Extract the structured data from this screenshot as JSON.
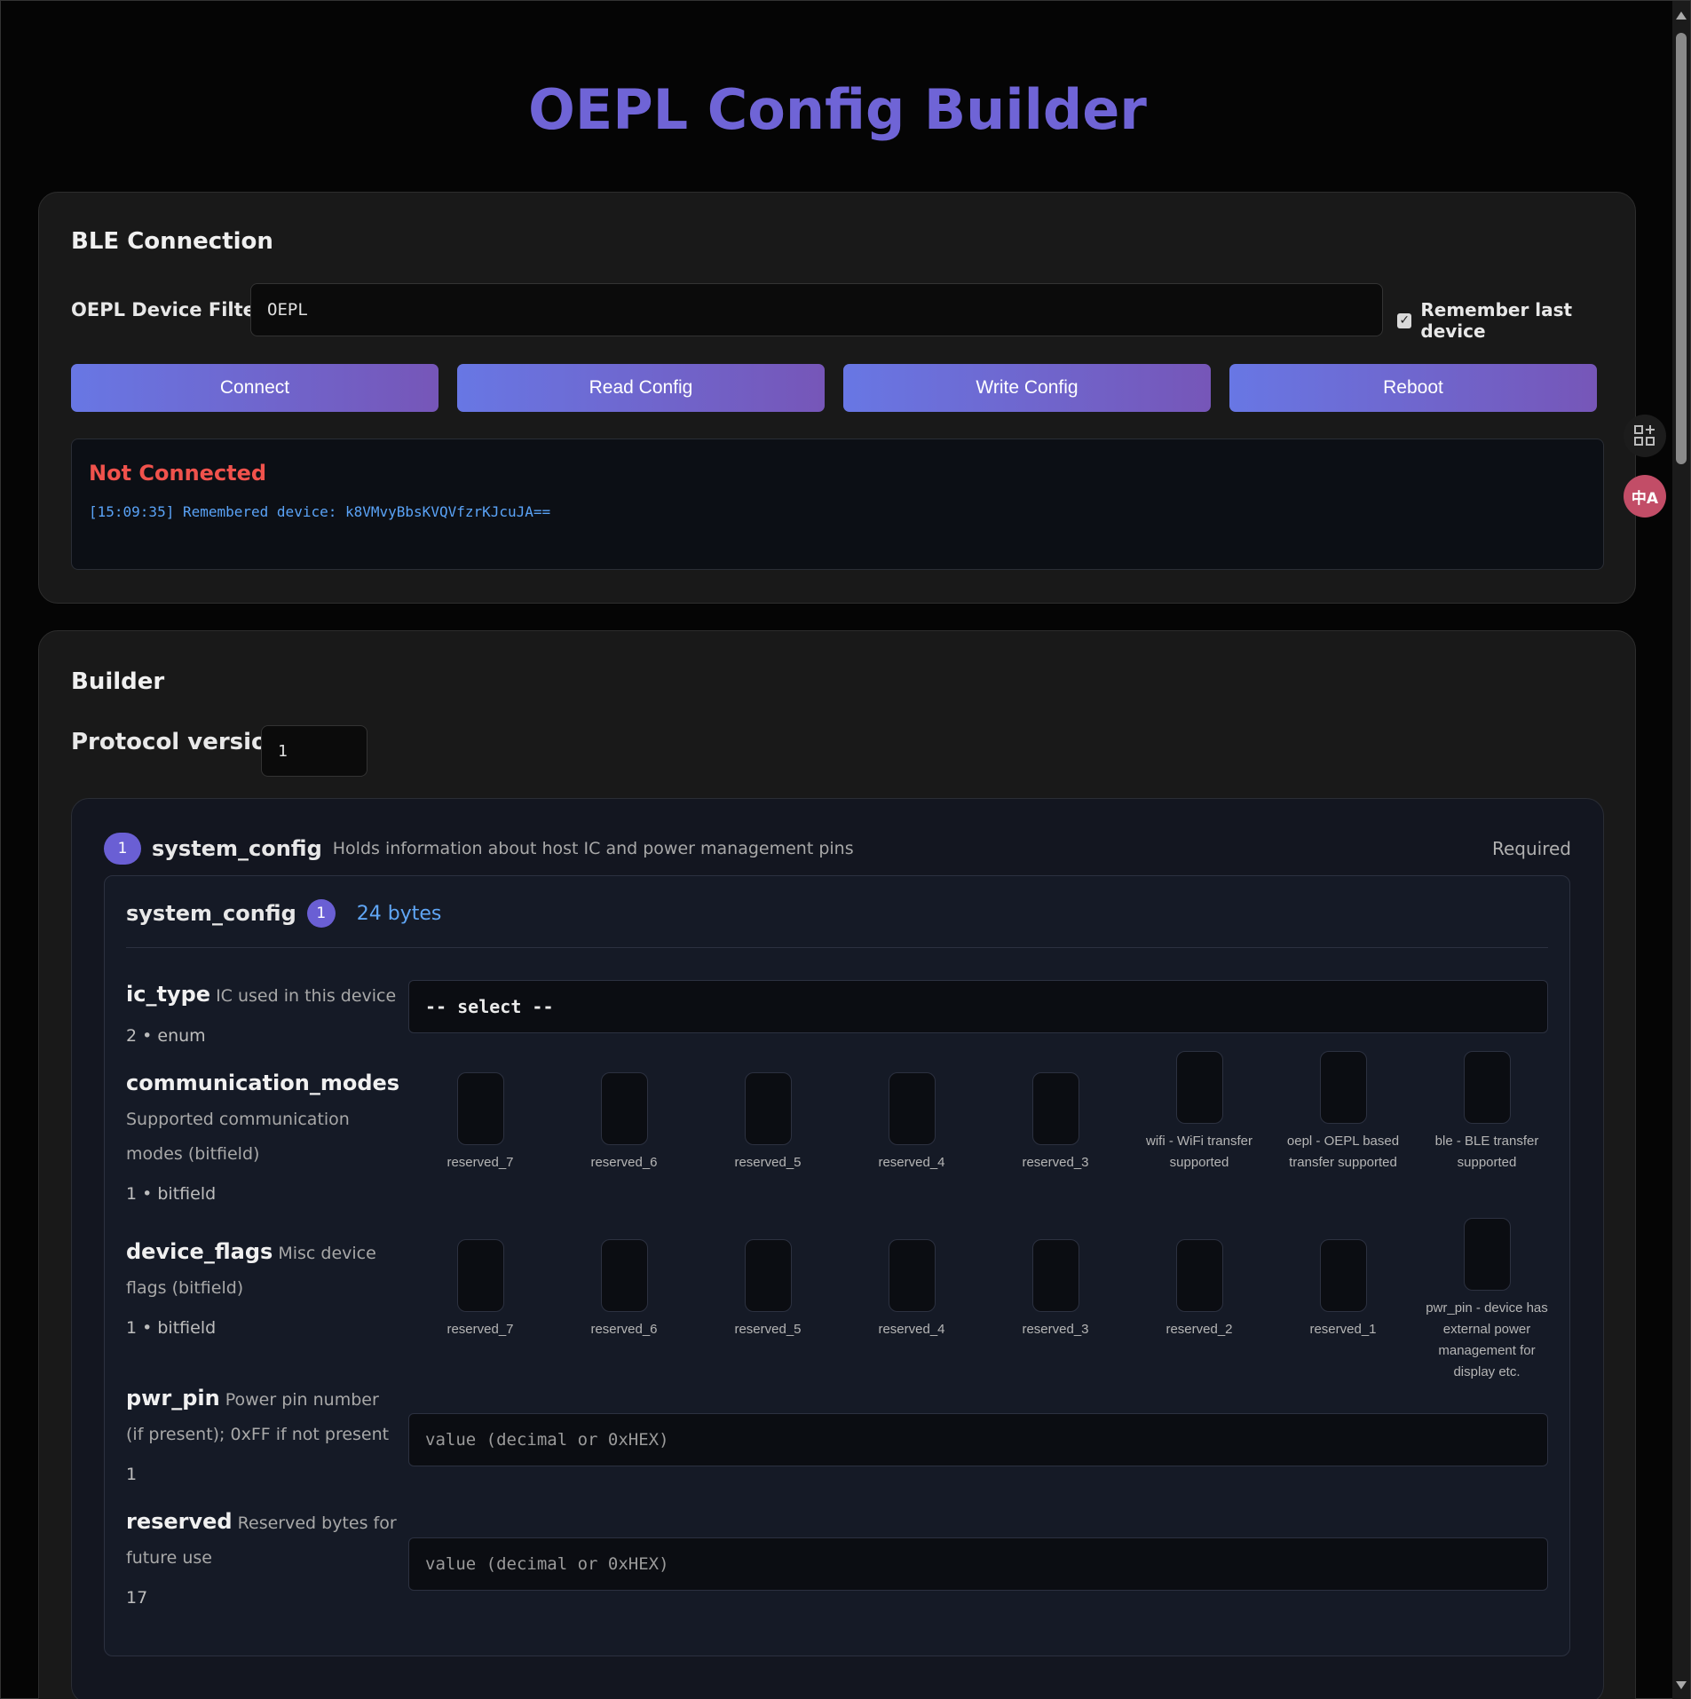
{
  "title": "OEPL Config Builder",
  "ble": {
    "heading": "BLE Connection",
    "filter_label": "OEPL Device Filter:",
    "filter_value": "OEPL",
    "remember_label": "Remember last device",
    "remember_checked": true,
    "buttons": {
      "connect": "Connect",
      "read": "Read Config",
      "write": "Write Config",
      "reboot": "Reboot"
    },
    "status": "Not Connected",
    "log": "[15:09:35] Remembered device: k8VMvyBbsKVQVfzrKJcuJA=="
  },
  "builder": {
    "heading": "Builder",
    "protocol_label": "Protocol version",
    "protocol_value": "1",
    "block": {
      "number": "1",
      "name": "system_config",
      "description": "Holds information about host IC and power management pins",
      "required": "Required",
      "inner_name": "system_config",
      "inner_number": "1",
      "bytes": "24 bytes",
      "fields": {
        "ic_type": {
          "name": "ic_type",
          "desc": "IC used in this device",
          "meta": "2 • enum",
          "select_value": "-- select --"
        },
        "communication_modes": {
          "name": "communication_modes",
          "desc": "Supported communication modes (bitfield)",
          "meta": "1 • bitfield",
          "bits": [
            "reserved_7",
            "reserved_6",
            "reserved_5",
            "reserved_4",
            "reserved_3",
            "wifi - WiFi transfer supported",
            "oepl - OEPL based transfer supported",
            "ble - BLE transfer supported"
          ]
        },
        "device_flags": {
          "name": "device_flags",
          "desc": "Misc device flags (bitfield)",
          "meta": "1 • bitfield",
          "bits": [
            "reserved_7",
            "reserved_6",
            "reserved_5",
            "reserved_4",
            "reserved_3",
            "reserved_2",
            "reserved_1",
            "pwr_pin - device has external power management for display etc."
          ]
        },
        "pwr_pin": {
          "name": "pwr_pin",
          "desc": "Power pin number (if present); 0xFF if not present",
          "meta": "1",
          "placeholder": "value (decimal or 0xHEX)"
        },
        "reserved": {
          "name": "reserved",
          "desc": "Reserved bytes for future use",
          "meta": "17",
          "placeholder": "value (decimal or 0xHEX)"
        }
      }
    }
  },
  "side_tools": {
    "grid": "grid-plus-icon",
    "translate": "translate-icon",
    "translate_glyph": "中A"
  },
  "colors": {
    "accent": "#6f64d6",
    "danger": "#f0524c",
    "link": "#60a6f5"
  }
}
